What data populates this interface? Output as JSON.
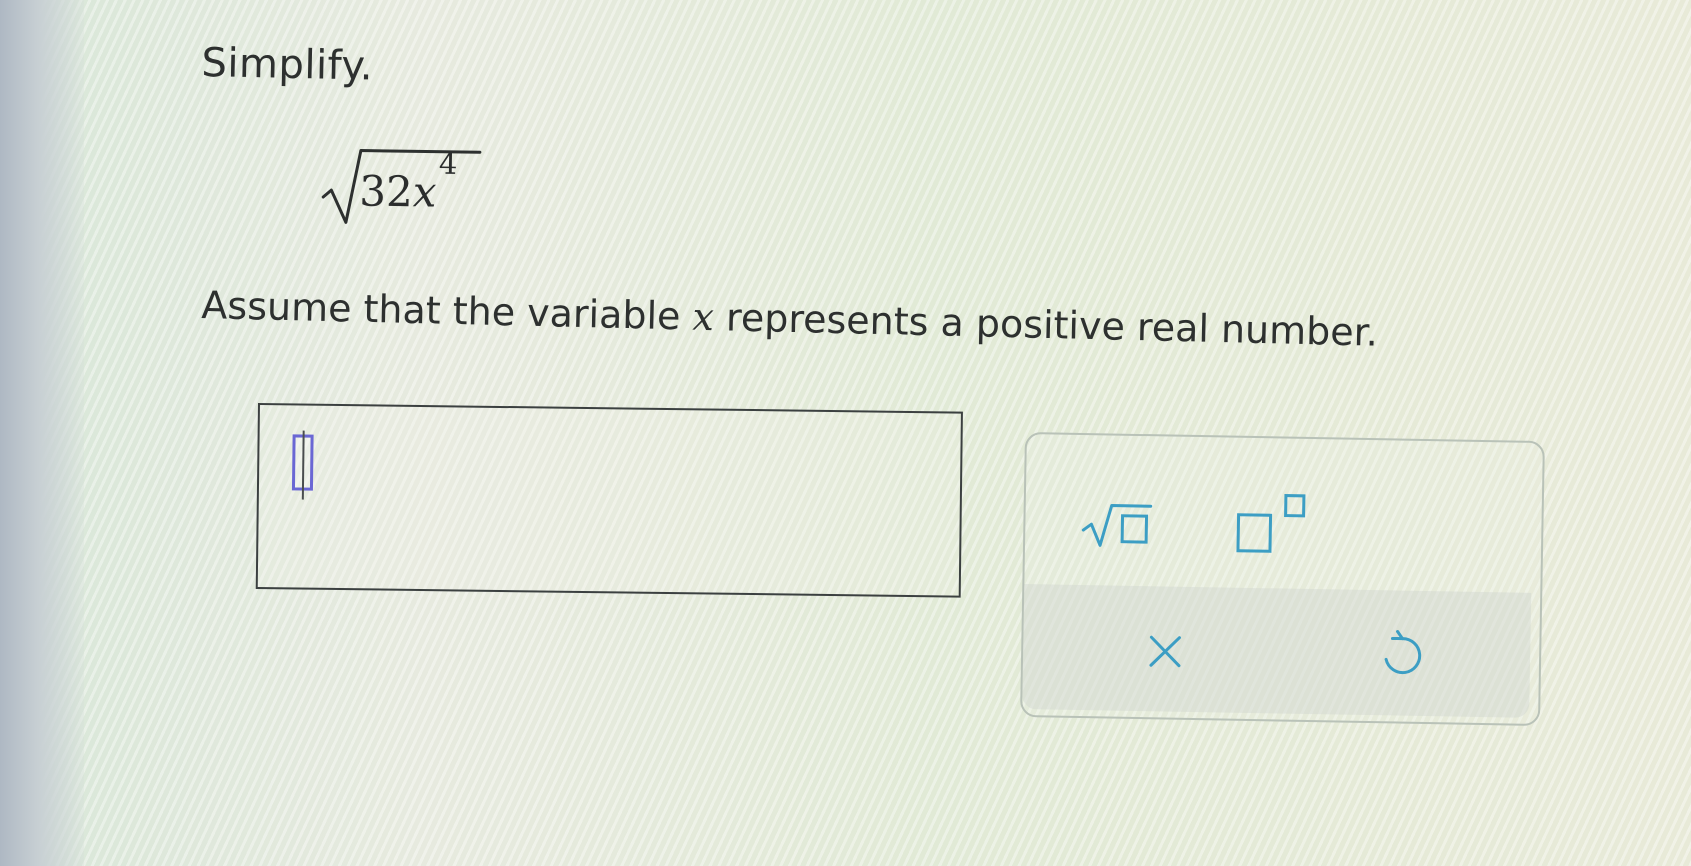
{
  "problem": {
    "prompt": "Simplify.",
    "radicand_coefficient": "32",
    "radicand_variable": "x",
    "radicand_exponent": "4",
    "instruction_before_variable": "Assume that the variable",
    "instruction_variable": "x",
    "instruction_after_variable": "represents a positive real number."
  },
  "answer_input": {
    "value": ""
  },
  "tools": {
    "square_root_icon": "square-root-template-icon",
    "superscript_icon": "superscript-template-icon",
    "clear_icon": "x-icon",
    "reset_icon": "undo-icon",
    "accent_color": "#3c9ec4",
    "cursor_color": "#6a67d4"
  }
}
